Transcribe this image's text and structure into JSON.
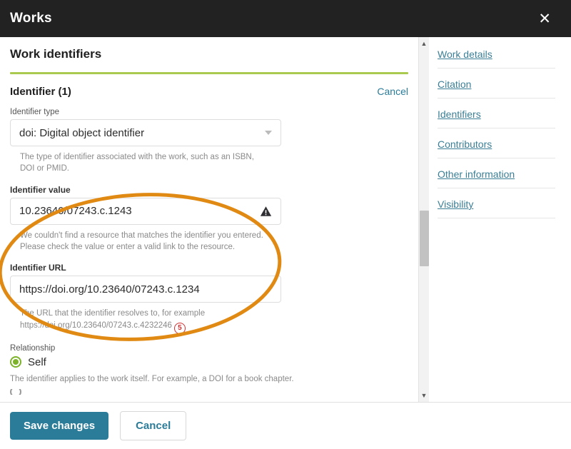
{
  "header": {
    "title": "Works",
    "close_icon": "close-icon"
  },
  "form": {
    "section_title": "Work identifiers",
    "identifier_heading": "Identifier (1)",
    "cancel_link": "Cancel",
    "identifier_type": {
      "label": "Identifier type",
      "value": "doi: Digital object identifier",
      "help": "The type of identifier associated with the work, such as an ISBN, DOI or PMID.",
      "caret_icon": "chevron-down-icon"
    },
    "identifier_value": {
      "label": "Identifier value",
      "value": "10.23640/07243.c.1243",
      "warning_icon": "warning-triangle-icon",
      "error": "We couldn't find a resource that matches the identifier you entered. Please check the value or enter a valid link to the resource."
    },
    "identifier_url": {
      "label": "Identifier URL",
      "value": "https://doi.org/10.23640/07243.c.1234",
      "help": "The URL that the identifier resolves to, for example https://doi.org/10.23640/07243.c.4232246",
      "annotation_mark": "5"
    },
    "relationship": {
      "label": "Relationship",
      "selected": "Self",
      "help": "The identifier applies to the work itself. For example, a DOI for a book chapter."
    }
  },
  "nav": {
    "items": [
      {
        "label": "Work details"
      },
      {
        "label": "Citation"
      },
      {
        "label": "Identifiers"
      },
      {
        "label": "Contributors"
      },
      {
        "label": "Other information"
      },
      {
        "label": "Visibility"
      }
    ]
  },
  "footer": {
    "save_label": "Save changes",
    "cancel_label": "Cancel"
  },
  "scrollbar": {
    "up_icon": "chevron-up-icon",
    "down_icon": "chevron-down-icon"
  },
  "colors": {
    "header_bg": "#222222",
    "accent_green": "#a9ca4e",
    "radio_green": "#7db32a",
    "link_teal": "#3b7f96",
    "button_teal": "#2b7c99",
    "annotation_orange": "#e08a14",
    "annotation_red": "#d03030"
  }
}
